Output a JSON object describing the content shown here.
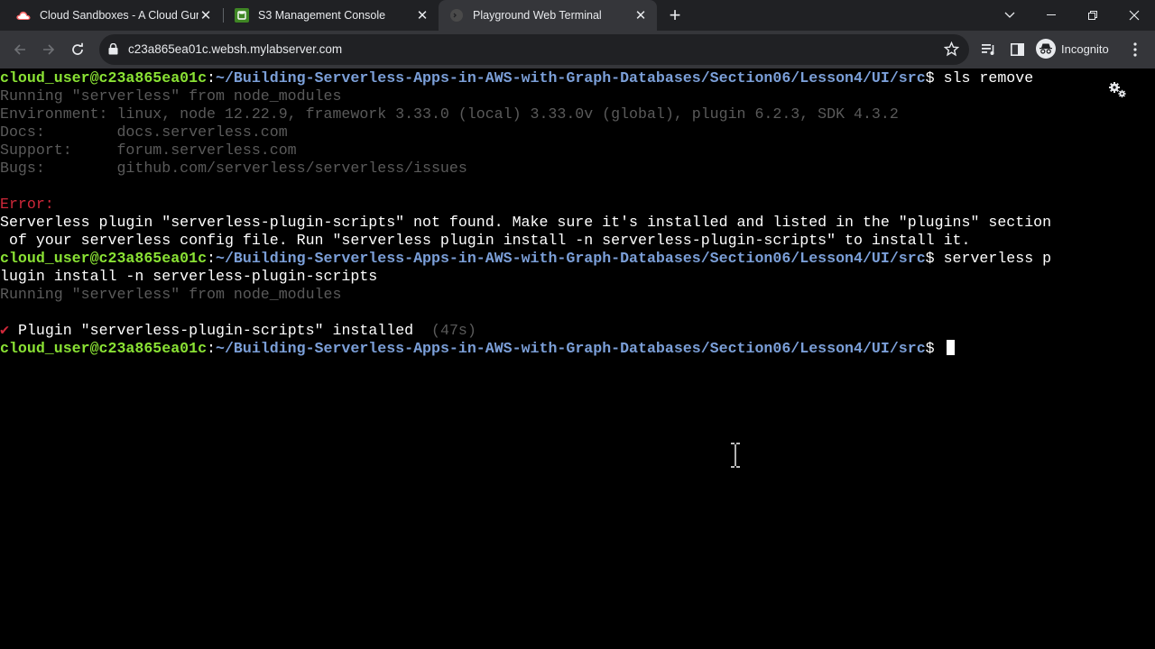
{
  "browser": {
    "tabs": [
      {
        "title": "Cloud Sandboxes - A Cloud Guru",
        "icon": "cloud-icon",
        "active": false
      },
      {
        "title": "S3 Management Console",
        "icon": "s3-icon",
        "active": false
      },
      {
        "title": "Playground Web Terminal",
        "icon": "terminal-icon",
        "active": true
      }
    ],
    "url": "c23a865ea01c.websh.mylabserver.com",
    "profile_label": "Incognito"
  },
  "terminal": {
    "prompt_user": "cloud_user@c23a865ea01c",
    "prompt_path": "~/Building-Serverless-Apps-in-AWS-with-Graph-Databases/Section06/Lesson4/UI/src",
    "prompt_symbol": "$ ",
    "line1_cmd": "sls remove",
    "running": "Running \"serverless\" from node_modules",
    "env_line": "Environment: linux, node 12.22.9, framework 3.33.0 (local) 3.33.0v (global), plugin 6.2.3, SDK 4.3.2",
    "docs_line": "Docs:        docs.serverless.com",
    "support_line": "Support:     forum.serverless.com",
    "bugs_line": "Bugs:        github.com/serverless/serverless/issues",
    "error_label": "Error:",
    "error_msg_1": "Serverless plugin \"serverless-plugin-scripts\" not found. Make sure it's installed and listed in the \"plugins\" section",
    "error_msg_2": " of your serverless config file. Run \"serverless plugin install -n serverless-plugin-scripts\" to install it.",
    "cmd2_part1": "serverless p",
    "cmd2_part2": "lugin install -n serverless-plugin-scripts",
    "running2": "Running \"serverless\" from node_modules",
    "check_mark": "✔",
    "installed_msg": " Plugin \"serverless-plugin-scripts\" installed",
    "installed_time": "  (47s)"
  },
  "colors": {
    "prompt_user": "#8ae234",
    "prompt_path": "#7b9fd8",
    "error": "#d0283a",
    "dim": "#5a5a5a"
  }
}
